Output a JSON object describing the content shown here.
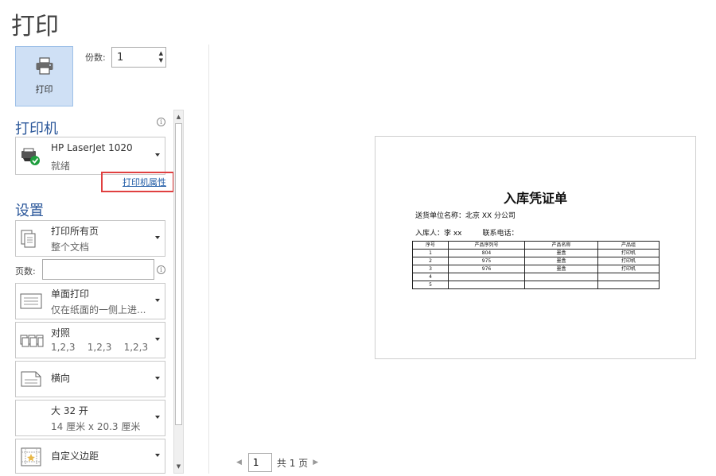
{
  "page_title": "打印",
  "print_button": {
    "label": "打印"
  },
  "copies": {
    "label": "份数:",
    "value": "1"
  },
  "printer": {
    "section_title": "打印机",
    "name": "HP LaserJet 1020",
    "status": "就绪",
    "properties_link": "打印机属性"
  },
  "settings": {
    "section_title": "设置",
    "print_range": {
      "title": "打印所有页",
      "subtitle": "整个文档"
    },
    "pages": {
      "label": "页数:",
      "value": ""
    },
    "sides": {
      "title": "单面打印",
      "subtitle": "仅在纸面的一侧上进..."
    },
    "collate": {
      "title": "对照",
      "subtitle": "1,2,3    1,2,3    1,2,3"
    },
    "orientation": {
      "title": "横向"
    },
    "paper_size": {
      "title": "大 32 开",
      "subtitle": "14 厘米 x 20.3 厘米"
    },
    "margins": {
      "title": "自定义边距"
    }
  },
  "preview": {
    "doc_title": "入库凭证单",
    "supplier_line": "送货单位名称：北京 XX 分公司",
    "receiver_line": "入库人：李 xx",
    "phone_line": "联系电话：",
    "table": {
      "headers": [
        "序号",
        "产品序列号",
        "产品名称",
        "产品组"
      ],
      "rows": [
        [
          "1",
          "804",
          "墨盒",
          "打印机"
        ],
        [
          "2",
          "975",
          "墨盒",
          "打印机"
        ],
        [
          "3",
          "976",
          "墨盒",
          "打印机"
        ],
        [
          "4",
          "",
          "",
          ""
        ],
        [
          "5",
          "",
          "",
          ""
        ]
      ]
    }
  },
  "pager": {
    "current": "1",
    "total_text": "共 1 页"
  },
  "colors": {
    "accent": "#2b579a",
    "print_button_bg": "#cfe0f5",
    "highlight": "#e04040",
    "link": "#1f5ba6"
  }
}
